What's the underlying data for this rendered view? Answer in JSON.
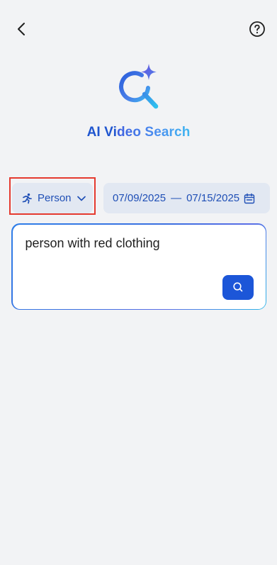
{
  "header": {
    "back_icon": "chevron-left-icon",
    "help_icon": "question-circle-icon"
  },
  "brand": {
    "title_part1": "AI Vi",
    "title_part2": "deo Search",
    "logo_icon": "sparkle-search-icon",
    "colors": {
      "title_blue": "#1f55cf",
      "gradient_start": "#3d5fe0",
      "gradient_end": "#3fb6f1"
    }
  },
  "filters": {
    "type": {
      "label": "Person",
      "icon": "running-person-icon",
      "chevron": "chevron-down-icon"
    },
    "date_range": {
      "start": "07/09/2025",
      "separator": "—",
      "end": "07/15/2025",
      "icon": "calendar-icon"
    }
  },
  "search": {
    "query": "person with red clothing",
    "button_icon": "search-icon",
    "button_color": "#1c56d8"
  },
  "annotation": {
    "highlight_color": "#e53a2f"
  }
}
